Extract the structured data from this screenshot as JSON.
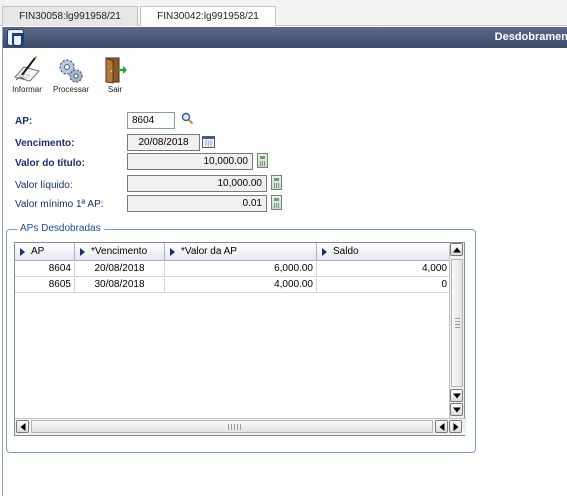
{
  "tabs": [
    {
      "label": "FIN30058:lg991958/21",
      "active": false
    },
    {
      "label": "FIN30042:lg991958/21",
      "active": true
    }
  ],
  "window": {
    "title": "Desdobramen"
  },
  "toolbar": {
    "informar": {
      "label": "Informar",
      "icon": "pen-paper-icon"
    },
    "processar": {
      "label": "Processar",
      "icon": "gears-icon"
    },
    "sair": {
      "label": "Sair",
      "icon": "exit-door-icon"
    }
  },
  "form": {
    "ap": {
      "label": "AP:",
      "value": "8604"
    },
    "vencimento": {
      "label": "Vencimento:",
      "value": "20/08/2018"
    },
    "valor_titulo": {
      "label": "Valor do título:",
      "value": "10,000.00"
    },
    "valor_liquido": {
      "label": "Valor líquido:",
      "value": "10,000.00"
    },
    "valor_minimo": {
      "label": "Valor mínimo 1ª AP:",
      "value": "0.01"
    }
  },
  "group": {
    "title": "APs Desdobradas"
  },
  "grid": {
    "columns": [
      "AP",
      "*Vencimento",
      "*Valor da AP",
      "Saldo"
    ],
    "rows": [
      {
        "ap": "8604",
        "vencimento": "20/08/2018",
        "valor": "6,000.00",
        "saldo": "4,000"
      },
      {
        "ap": "8605",
        "vencimento": "30/08/2018",
        "valor": "4,000.00",
        "saldo": "0"
      }
    ]
  },
  "colors": {
    "title_bar": "#3d4a69",
    "label_text": "#1b2d70",
    "group_border": "#7a9acb"
  }
}
